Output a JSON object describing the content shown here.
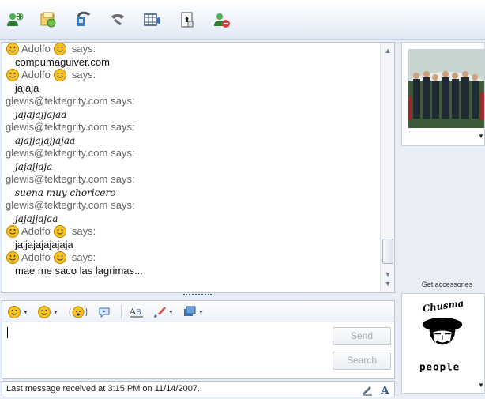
{
  "toolbar": {
    "icons": [
      "invite-contact-icon",
      "send-files-icon",
      "video-call-icon",
      "call-icon",
      "activities-icon",
      "games-icon",
      "block-contact-icon"
    ]
  },
  "conversation": {
    "entries": [
      {
        "sender": "Adolfo",
        "emoticons": true,
        "says": "says:",
        "text": "compumaguiver.com",
        "style": "plain"
      },
      {
        "sender": "Adolfo",
        "emoticons": true,
        "says": "says:",
        "text": "jajaja",
        "style": "plain"
      },
      {
        "sender": "glewis@tektegrity.com",
        "emoticons": false,
        "says": "says:",
        "text": "jajajajjajaa",
        "style": "italic"
      },
      {
        "sender": "glewis@tektegrity.com",
        "emoticons": false,
        "says": "says:",
        "text": "ajajjajajjajaa",
        "style": "italic"
      },
      {
        "sender": "glewis@tektegrity.com",
        "emoticons": false,
        "says": "says:",
        "text": "jajajjaja",
        "style": "italic"
      },
      {
        "sender": "glewis@tektegrity.com",
        "emoticons": false,
        "says": "says:",
        "text": "suena muy choricero",
        "style": "italic"
      },
      {
        "sender": "glewis@tektegrity.com",
        "emoticons": false,
        "says": "says:",
        "text": "jajajjajaa",
        "style": "italic"
      },
      {
        "sender": "Adolfo",
        "emoticons": true,
        "says": "says:",
        "text": "jajjajajajajaja",
        "style": "plain"
      },
      {
        "sender": "Adolfo",
        "emoticons": true,
        "says": "says:",
        "text": "mae me saco las lagrimas...",
        "style": "plain"
      }
    ]
  },
  "input": {
    "send_label": "Send",
    "search_label": "Search"
  },
  "status": {
    "text": "Last message received at 3:15 PM on 11/14/2007."
  },
  "sidebar": {
    "get_accessories": "Get accessories",
    "avatar_text_top": "Chusma",
    "avatar_text_bottom": "people"
  },
  "colors": {
    "accent": "#3b6fb6",
    "smiley": "#f7c21f"
  }
}
